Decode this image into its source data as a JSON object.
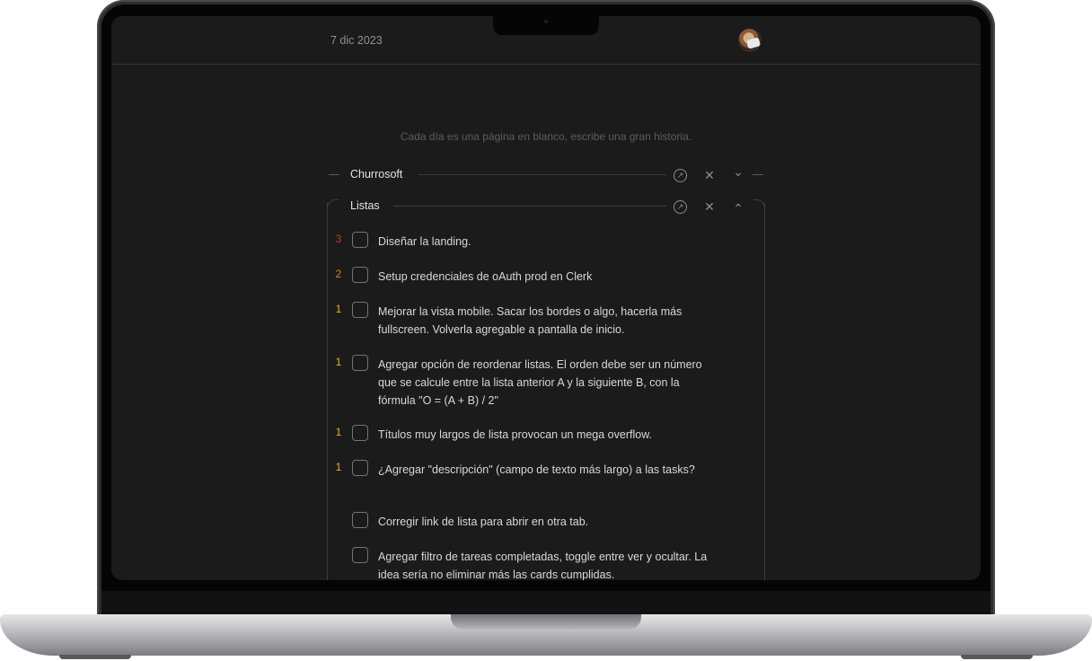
{
  "header": {
    "date": "7 dic 2023"
  },
  "placeholder": "Cada día es una página en blanco, escribe una gran historia.",
  "sections": [
    {
      "title": "Churrosoft",
      "collapsed": true
    },
    {
      "title": "Listas",
      "collapsed": false
    }
  ],
  "icons": {
    "open": "arrow-up-right-circle-icon",
    "close": "close-icon",
    "expand": "chevron-down-icon",
    "collapse": "chevron-up-icon"
  },
  "glyphs": {
    "open": "↗",
    "close": "✕",
    "down": "⌄",
    "up": "⌃"
  },
  "priority_colors": {
    "3": "#c0392b",
    "2": "#d4862c",
    "1": "#e5b52d"
  },
  "tasks": [
    {
      "priority": "3",
      "text": "Diseñar la landing."
    },
    {
      "priority": "2",
      "text": "Setup credenciales de oAuth prod en Clerk"
    },
    {
      "priority": "1",
      "text": "Mejorar la vista mobile. Sacar los bordes o algo, hacerla más fullscreen. Volverla agregable a pantalla de inicio."
    },
    {
      "priority": "1",
      "text": "Agregar opción de reordenar listas. El orden debe ser un número que se calcule entre la lista anterior A y la siguiente B, con la fórmula \"O = (A + B) / 2\""
    },
    {
      "priority": "1",
      "text": "Títulos muy largos de lista provocan un mega overflow."
    },
    {
      "priority": "1",
      "text": "¿Agregar \"descripción\" (campo de texto más largo) a las tasks?"
    },
    {
      "priority": "",
      "text": "Corregir link de lista para abrir en otra tab."
    },
    {
      "priority": "",
      "text": "Agregar filtro de tareas completadas, toggle entre ver y ocultar. La idea sería no eliminar más las cards cumplidas."
    }
  ]
}
